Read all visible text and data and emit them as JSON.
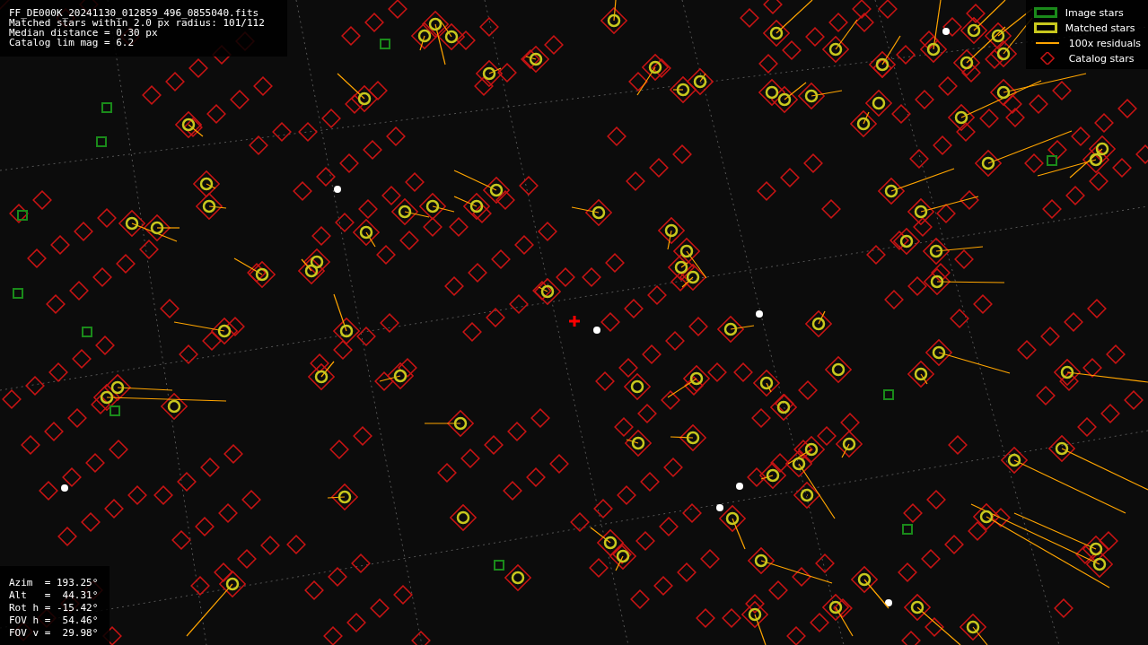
{
  "info": {
    "lines": [
      "FF_DE000K_20241130_012859_496_0855040.fits",
      "Matched stars within 2.0 px radius: 101/112",
      "Median distance = 0.30 px",
      "Catalog lim mag = 6.2"
    ]
  },
  "legend": [
    {
      "kind": "box",
      "color": "#1a8a1a",
      "label": "Image stars"
    },
    {
      "kind": "box",
      "color": "#c8c81e",
      "label": "Matched stars"
    },
    {
      "kind": "line",
      "color": "#ffa500",
      "label": "100x residuals"
    },
    {
      "kind": "diamond",
      "color": "#c81414",
      "label": "Catalog stars"
    }
  ],
  "pointing": {
    "lines": [
      "Azim  = 193.25°",
      "Alt   =  44.31°",
      "Rot h = -15.42°",
      "FOV h =  54.46°",
      "FOV v =  29.98°"
    ]
  }
}
